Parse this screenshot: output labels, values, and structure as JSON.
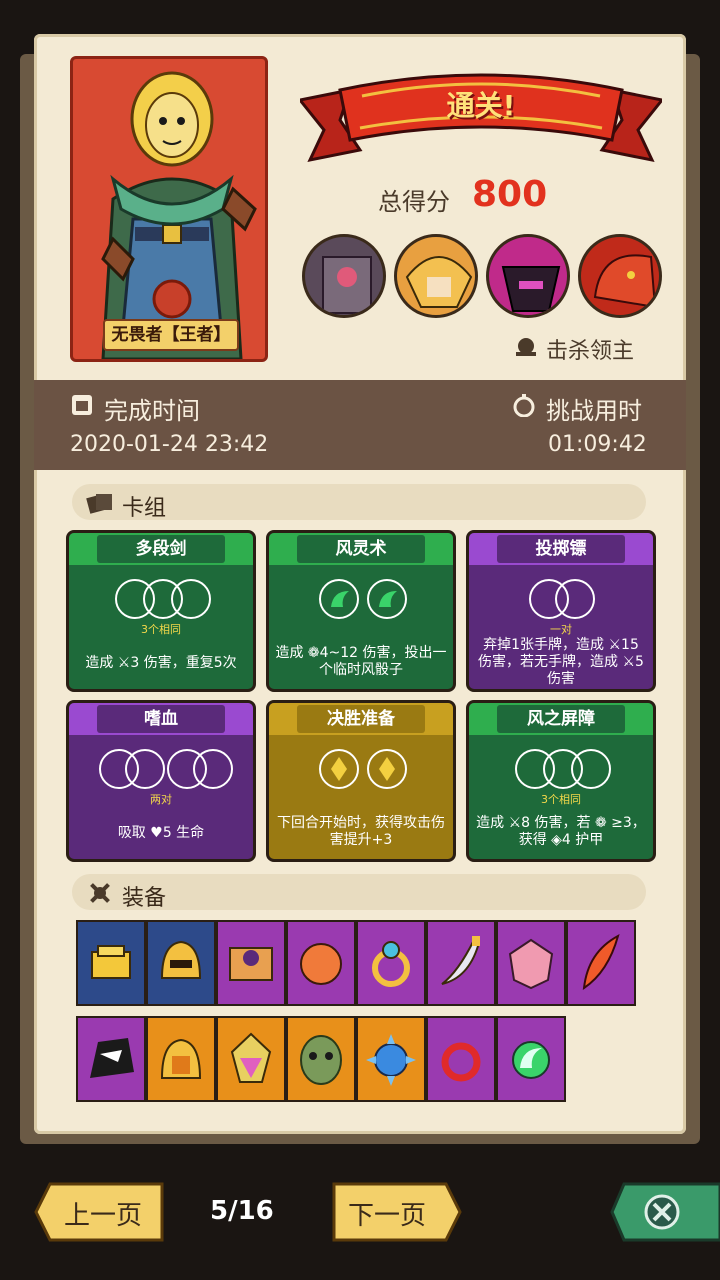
{
  "hero": {
    "name": "无畏者【王者】"
  },
  "result": {
    "banner": "通关!",
    "score_label": "总得分",
    "score": "800"
  },
  "bosses": {
    "label": "击杀领主",
    "icons": [
      "boss-stone-tower-icon",
      "boss-eagle-helmet-icon",
      "boss-dark-mech-icon",
      "boss-red-dragon-icon"
    ]
  },
  "time": {
    "finish_label": "完成时间",
    "finish_value": "2020-01-24 23:42",
    "challenge_label": "挑战用时",
    "challenge_value": "01:09:42"
  },
  "deck": {
    "title": "卡组",
    "cards": [
      {
        "name": "多段剑",
        "color": "green",
        "sub": "3个相同",
        "desc": "造成 ⚔3 伤害，重复5次"
      },
      {
        "name": "风灵术",
        "color": "green",
        "sub": "",
        "desc": "造成 ❁4~12 伤害，投出一个临时风骰子"
      },
      {
        "name": "投掷镖",
        "color": "purple",
        "sub": "一对",
        "desc": "弃掉1张手牌，造成 ⚔15 伤害，若无手牌，造成 ⚔5 伤害"
      },
      {
        "name": "嗜血",
        "color": "purple",
        "sub": "两对",
        "desc": "吸取 ♥5 生命"
      },
      {
        "name": "决胜准备",
        "color": "gold",
        "sub": "",
        "desc": "下回合开始时，获得攻击伤害提升+3"
      },
      {
        "name": "风之屏障",
        "color": "green",
        "sub": "3个相同",
        "desc": "造成 ⚔8 伤害，若 ❁ ≥3，获得 ◈4 护甲"
      }
    ]
  },
  "equipment": {
    "title": "装备",
    "row1": [
      {
        "icon": "gold-bars-icon",
        "color": "#2d4a8a"
      },
      {
        "icon": "golden-helmet-icon",
        "color": "#2d4a8a"
      },
      {
        "icon": "skull-book-icon",
        "color": "#9a3ab0"
      },
      {
        "icon": "orange-orb-icon",
        "color": "#9a3ab0"
      },
      {
        "icon": "gold-ring-icon",
        "color": "#9a3ab0"
      },
      {
        "icon": "curved-dagger-icon",
        "color": "#9a3ab0"
      },
      {
        "icon": "pink-dice-icon",
        "color": "#9a3ab0"
      },
      {
        "icon": "fire-feather-icon",
        "color": "#9a3ab0"
      }
    ],
    "row2": [
      {
        "icon": "shadow-beast-icon",
        "color": "#9a3ab0"
      },
      {
        "icon": "horned-helmet-icon",
        "color": "#e8901a"
      },
      {
        "icon": "crystal-gem-icon",
        "color": "#e8901a"
      },
      {
        "icon": "zombie-mask-icon",
        "color": "#e8901a"
      },
      {
        "icon": "spiked-orb-icon",
        "color": "#e8901a"
      },
      {
        "icon": "red-ring-icon",
        "color": "#9a3ab0"
      },
      {
        "icon": "wind-gem-icon",
        "color": "#9a3ab0"
      }
    ]
  },
  "nav": {
    "prev": "上一页",
    "next": "下一页",
    "page": "5/16"
  }
}
